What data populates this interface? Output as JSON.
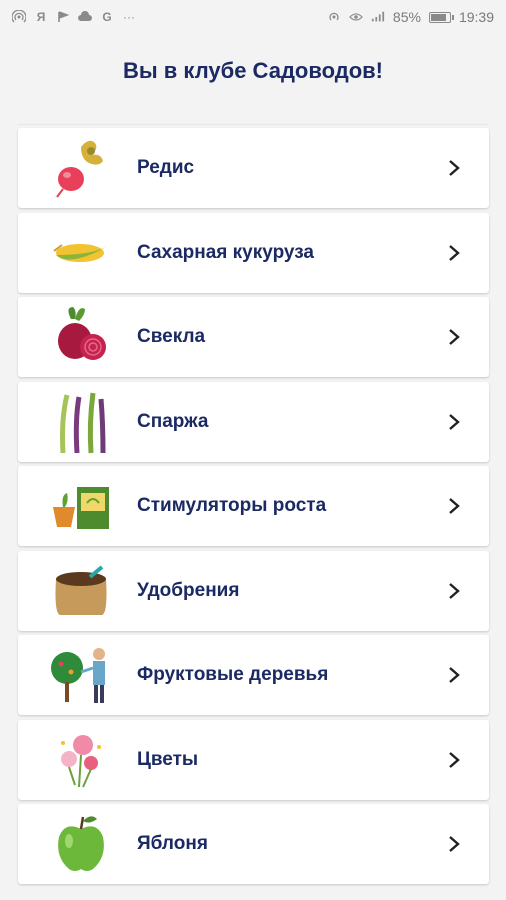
{
  "status": {
    "left_icons": [
      "hotspot-icon",
      "yandex-icon",
      "flag-icon",
      "cloud-icon",
      "google-icon",
      "more-icon"
    ],
    "right_text": "85%",
    "time": "19:39"
  },
  "header": {
    "title": "Вы в клубе Садоводов!"
  },
  "items": [
    {
      "label": "Редис",
      "icon": "radish-icon"
    },
    {
      "label": "Сахарная кукуруза",
      "icon": "corn-icon"
    },
    {
      "label": "Свекла",
      "icon": "beet-icon"
    },
    {
      "label": "Спаржа",
      "icon": "asparagus-icon"
    },
    {
      "label": "Стимуляторы роста",
      "icon": "growth-stimulator-icon"
    },
    {
      "label": "Удобрения",
      "icon": "fertilizer-icon"
    },
    {
      "label": "Фруктовые деревья",
      "icon": "fruit-tree-icon"
    },
    {
      "label": "Цветы",
      "icon": "flowers-icon"
    },
    {
      "label": "Яблоня",
      "icon": "apple-icon"
    }
  ],
  "colors": {
    "accent": "#1b2a63",
    "background": "#f3f3f3",
    "card": "#ffffff"
  }
}
